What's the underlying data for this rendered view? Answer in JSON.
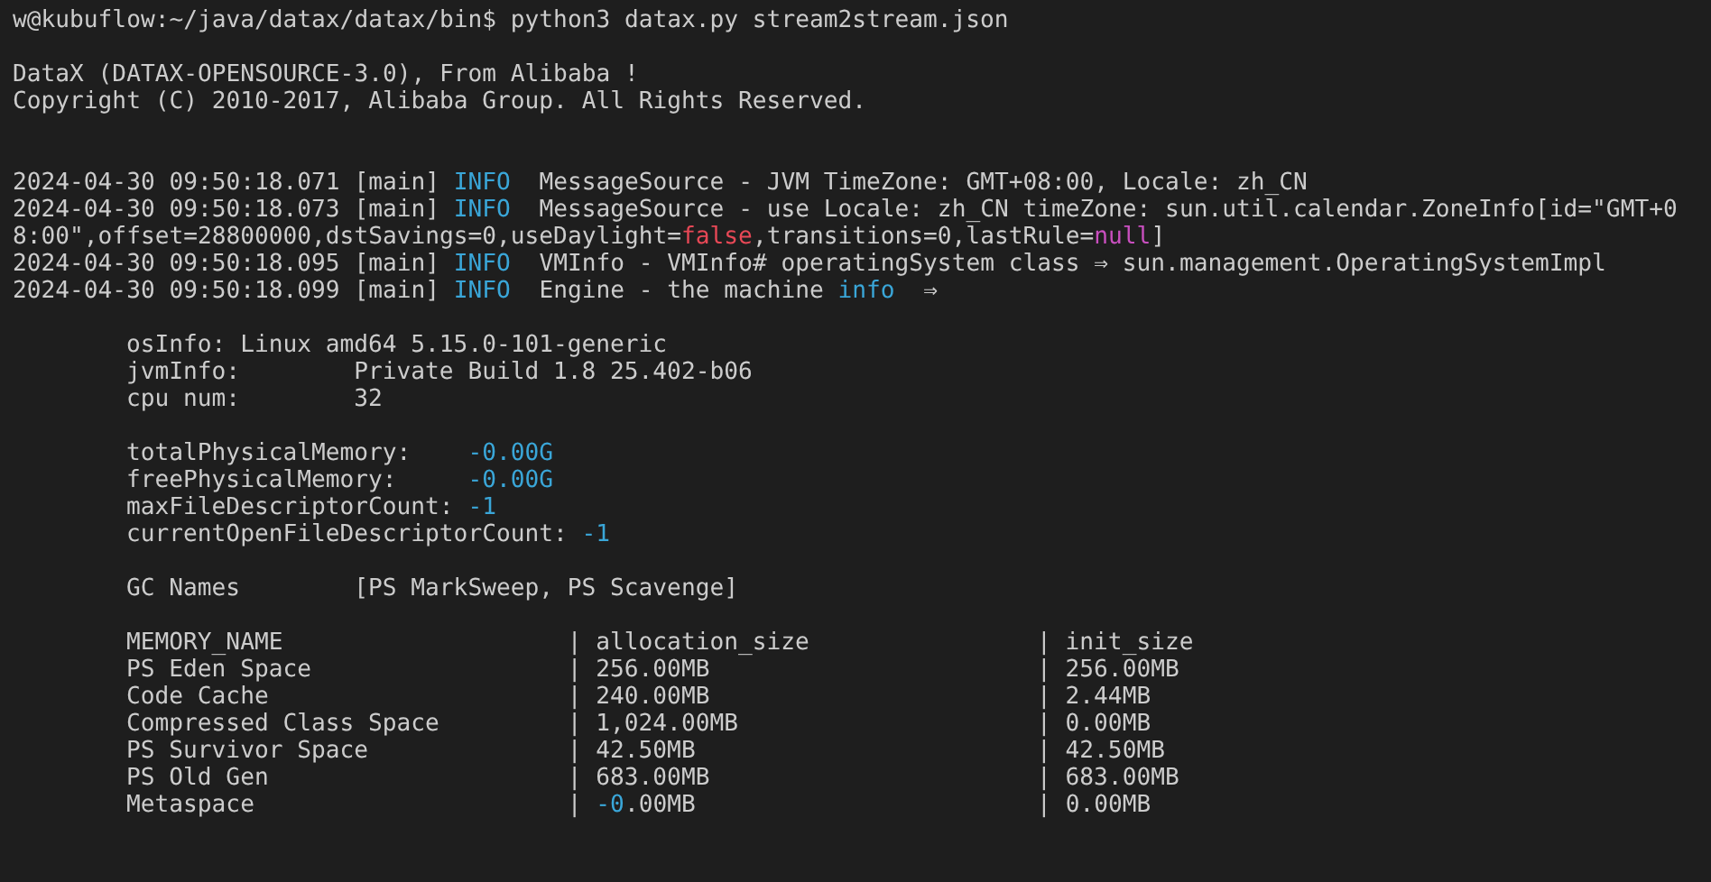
{
  "terminal": {
    "blocks": [
      {
        "kind": "command",
        "lines": [
          [
            {
              "text": "w@kubuflow:~/java/datax/datax/bin$ python3 datax.py stream2stream.json",
              "kind": "text"
            }
          ]
        ]
      },
      {
        "kind": "banner",
        "lines": [
          [
            {
              "text": "DataX (DATAX-OPENSOURCE-3.0), From Alibaba !",
              "kind": "text"
            }
          ],
          [
            {
              "text": "Copyright (C) 2010-2017, Alibaba Group. All Rights Reserved.",
              "kind": "text"
            }
          ]
        ]
      },
      {
        "kind": "log",
        "lines": [
          [
            {
              "text": "2024-04-30 09:50:18.071 [main] ",
              "kind": "text"
            },
            {
              "text": "INFO",
              "kind": "keyword"
            },
            {
              "text": "  MessageSource - JVM TimeZone: GMT+08:00, Locale: zh_CN",
              "kind": "text"
            }
          ],
          [
            {
              "text": "2024-04-30 09:50:18.073 [main] ",
              "kind": "text"
            },
            {
              "text": "INFO",
              "kind": "keyword"
            },
            {
              "text": "  MessageSource - use Locale: zh_CN timeZone: sun.util.calendar.ZoneInfo[id=\"GMT+0",
              "kind": "text"
            }
          ],
          [
            {
              "text": "8:00\",offset=28800000,dstSavings=0,useDaylight=",
              "kind": "text"
            },
            {
              "text": "false",
              "kind": "boolean"
            },
            {
              "text": ",transitions=0,lastRule=",
              "kind": "text"
            },
            {
              "text": "null",
              "kind": "null"
            },
            {
              "text": "]",
              "kind": "text"
            }
          ],
          [
            {
              "text": "2024-04-30 09:50:18.095 [main] ",
              "kind": "text"
            },
            {
              "text": "INFO",
              "kind": "keyword"
            },
            {
              "text": "  VMInfo - VMInfo# operatingSystem class ⇒ sun.management.OperatingSystemImpl",
              "kind": "text"
            }
          ],
          [
            {
              "text": "2024-04-30 09:50:18.099 [main] ",
              "kind": "text"
            },
            {
              "text": "INFO",
              "kind": "keyword"
            },
            {
              "text": "  Engine - the machine ",
              "kind": "text"
            },
            {
              "text": "info",
              "kind": "keyword"
            },
            {
              "text": "  ⇒",
              "kind": "text"
            }
          ]
        ]
      },
      {
        "kind": "info",
        "lines": [
          [
            {
              "text": "osInfo: Linux amd64 5.15.0-101-generic",
              "kind": "text"
            }
          ],
          [
            {
              "text": "jvmInfo:        Private Build 1.8 25.402-b06",
              "kind": "text"
            }
          ],
          [
            {
              "text": "cpu num:        32",
              "kind": "text"
            }
          ]
        ]
      },
      {
        "kind": "info",
        "lines": [
          [
            {
              "text": "totalPhysicalMemory:    ",
              "kind": "text"
            },
            {
              "text": "-0.00G",
              "kind": "keyword"
            }
          ],
          [
            {
              "text": "freePhysicalMemory:     ",
              "kind": "text"
            },
            {
              "text": "-0.00G",
              "kind": "keyword"
            }
          ],
          [
            {
              "text": "maxFileDescriptorCount: ",
              "kind": "text"
            },
            {
              "text": "-1",
              "kind": "keyword"
            }
          ],
          [
            {
              "text": "currentOpenFileDescriptorCount: ",
              "kind": "text"
            },
            {
              "text": "-1",
              "kind": "keyword"
            }
          ]
        ]
      },
      {
        "kind": "info",
        "lines": [
          [
            {
              "text": "GC Names        [PS MarkSweep, PS Scavenge]",
              "kind": "text"
            }
          ]
        ]
      },
      {
        "kind": "table",
        "lines": [
          [
            {
              "text": "MEMORY_NAME                    | allocation_size                | init_size",
              "kind": "text"
            }
          ],
          [
            {
              "text": "PS Eden Space                  | 256.00MB                       | 256.00MB",
              "kind": "text"
            }
          ],
          [
            {
              "text": "Code Cache                     | 240.00MB                       | 2.44MB",
              "kind": "text"
            }
          ],
          [
            {
              "text": "Compressed Class Space         | 1,024.00MB                     | 0.00MB",
              "kind": "text"
            }
          ],
          [
            {
              "text": "PS Survivor Space              | 42.50MB                        | 42.50MB",
              "kind": "text"
            }
          ],
          [
            {
              "text": "PS Old Gen                     | 683.00MB                       | 683.00MB",
              "kind": "text"
            }
          ],
          [
            {
              "text": "Metaspace                      | ",
              "kind": "text"
            },
            {
              "text": "-0",
              "kind": "keyword"
            },
            {
              "text": ".00MB                        | 0.00MB",
              "kind": "text"
            }
          ]
        ]
      }
    ]
  }
}
